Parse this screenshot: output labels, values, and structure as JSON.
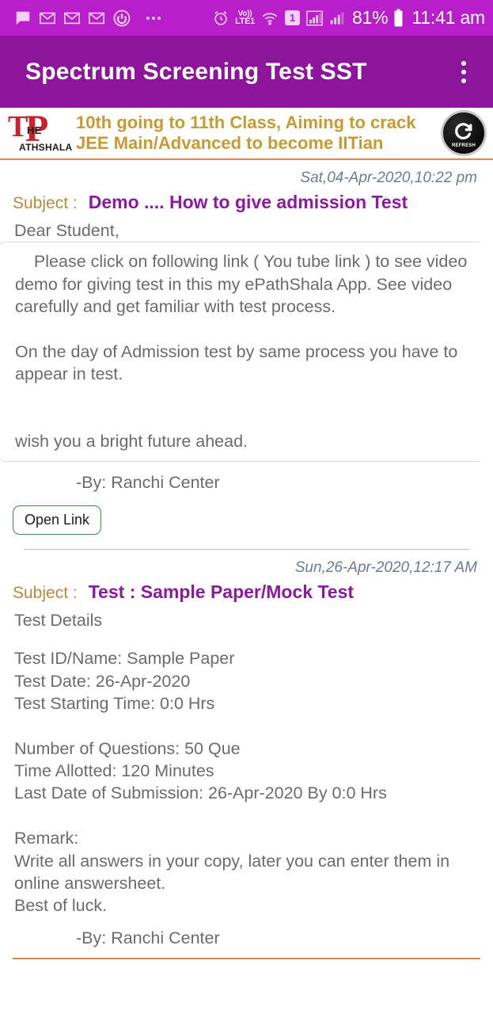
{
  "status_bar": {
    "time": "11:41 am",
    "battery_percent": "81%",
    "volte_line1": "Vo))",
    "volte_line2": "LTE1",
    "sim_badge": "1",
    "icons": [
      "chat-bubble-icon",
      "gmail-icon",
      "gmail-icon",
      "gmail-icon",
      "power-circle-icon",
      "more-dots-icon",
      "alarm-clock-icon",
      "volte-icon",
      "wifi-icon",
      "sim-card-icon",
      "signal-bars-icon",
      "signal-bars-small-icon",
      "battery-icon"
    ],
    "background": "#b81ec9"
  },
  "app_bar": {
    "title": "Spectrum Screening Test SST",
    "overflow_menu_name": "more-options",
    "background": "#8c159b"
  },
  "banner": {
    "logo": {
      "letter_t": "T",
      "letter_p": "P",
      "word_he": "HE",
      "word_athshala": "ATHSHALA"
    },
    "text_line1": "10th going to 11th Class, Aiming to crack",
    "text_line2": "JEE Main/Advanced to become IITian",
    "text_color": "#c79a32",
    "refresh_label": "REFRESH",
    "rule_color": "#d98a3c"
  },
  "messages": [
    {
      "date": "Sat,04-Apr-2020,10:22 pm",
      "subject_label": "Subject :",
      "subject": "Demo .... How to give admission Test",
      "greeting": "Dear Student,",
      "body": "    Please click on following link ( You tube link ) to see video demo for giving test in this my ePathShala App. See video carefully and get familiar with test process.\n\nOn the day of Admission test by same process you have to appear in test.\n\n\nwish you a bright future ahead.",
      "signature": "-By: Ranchi Center",
      "button_label": "Open Link"
    },
    {
      "date": "Sun,26-Apr-2020,12:17 AM",
      "subject_label": "Subject :",
      "subject": "Test : Sample Paper/Mock Test",
      "heading": "Test Details",
      "details": "Test ID/Name: Sample Paper\nTest Date: 26-Apr-2020\nTest Starting Time: 0:0 Hrs\n\nNumber of Questions: 50 Que\nTime Allotted: 120 Minutes\nLast Date of Submission: 26-Apr-2020 By 0:0 Hrs\n\nRemark:\nWrite all answers in your copy, later you can enter them in online answersheet.\nBest of luck.",
      "signature": "-By: Ranchi Center"
    }
  ],
  "colors": {
    "subject_label": "#b98a3d",
    "subject_value": "#8c1a9e",
    "body_text": "#6b6b6b",
    "date_text": "#6d7a94",
    "open_link_border": "#3f8a47",
    "logo_red": "#c9242b"
  }
}
